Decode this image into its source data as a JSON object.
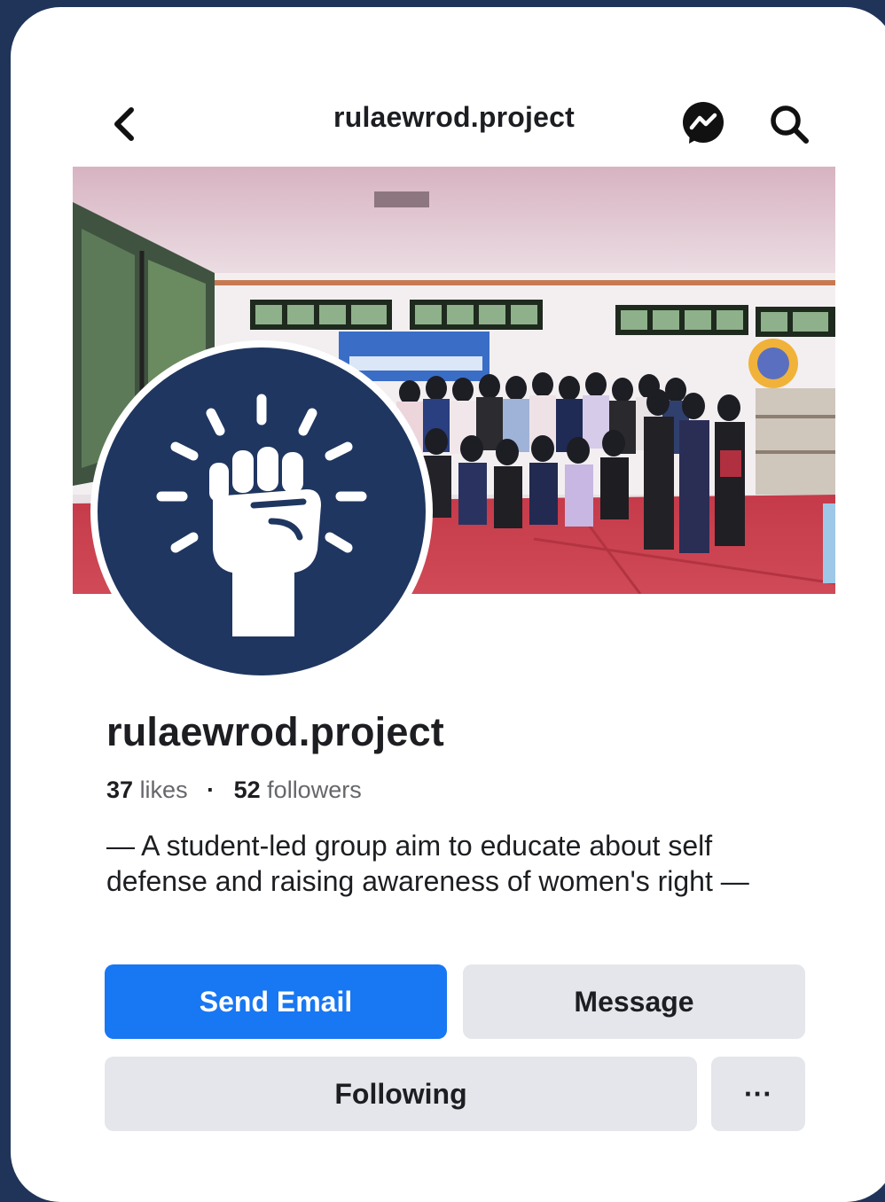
{
  "header": {
    "title": "rulaewrod.project",
    "icons": [
      "back-chevron",
      "messenger-icon",
      "search-icon"
    ]
  },
  "profile": {
    "name": "rulaewrod.project",
    "likes_count": "37",
    "likes_label": "likes",
    "followers_count": "52",
    "followers_label": "followers",
    "separator": "·",
    "bio": "— A student-led group aim to educate about self defense and raising awareness of women's right —"
  },
  "buttons": {
    "send_email": "Send Email",
    "message": "Message",
    "following": "Following",
    "more": "···"
  },
  "colors": {
    "background": "#1f3458",
    "primary_button": "#1877f2",
    "secondary_button": "#e4e6eb",
    "avatar_bg": "#1f3660",
    "mat_red": "#c9303e"
  }
}
